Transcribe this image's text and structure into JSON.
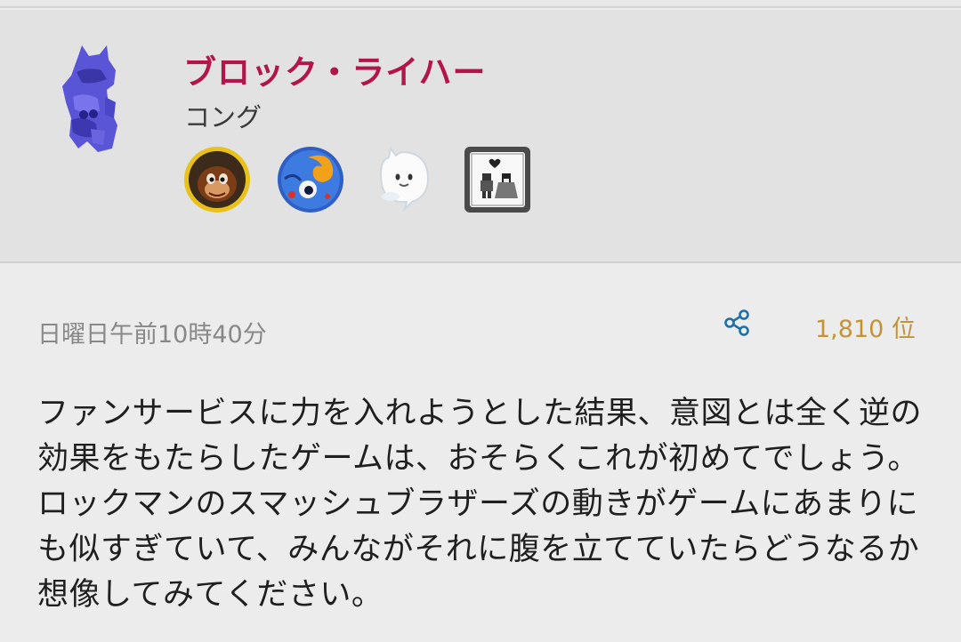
{
  "post": {
    "author_name": "ブロック・ライハー",
    "country": "コング",
    "badges": [
      {
        "name": "donkey-kong-badge-icon"
      },
      {
        "name": "blue-fish-badge-icon"
      },
      {
        "name": "boo-ghost-badge-icon"
      },
      {
        "name": "pixel-couple-badge-icon"
      }
    ],
    "timestamp": "日曜日午前10時40分",
    "rank": "1,810 位",
    "body": "ファンサービスに力を入れようとした結果、意図とは全く逆の効果をもたらしたゲームは、おそらくこれが初めてでしょう。ロックマンのスマッシュブラザーズの動きがゲームにあまりにも似すぎていて、みんながそれに腹を立てていたらどうなるか想像してみてください。"
  },
  "colors": {
    "author_name": "#b3154a",
    "rank": "#c39337",
    "share_icon": "#1f6fa6",
    "background": "#ececec",
    "header_background": "#e2e2e2"
  }
}
